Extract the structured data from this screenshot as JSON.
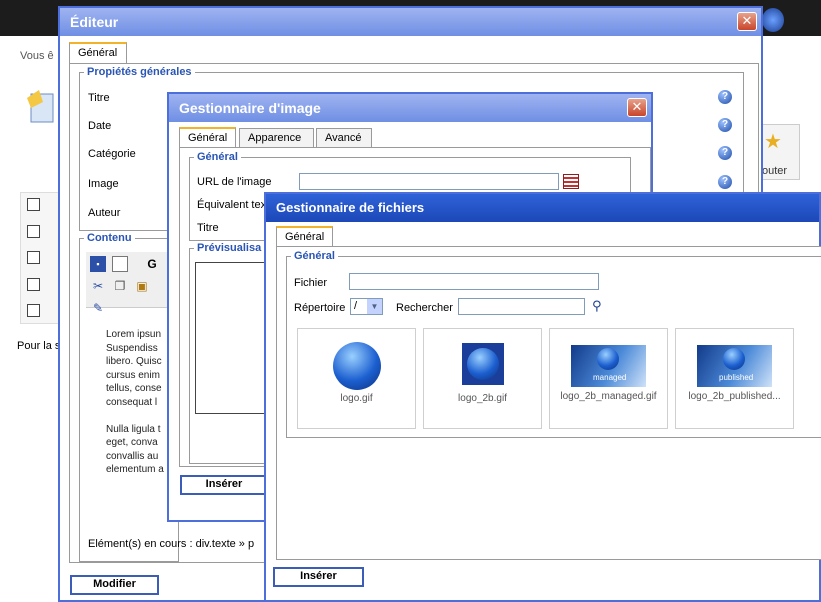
{
  "background": {
    "breadcrumb_fragment": "Vous ê",
    "page_text_fragment": "Pour la s",
    "add_button_fragment": "outer"
  },
  "editor": {
    "title": "Éditeur",
    "close_symbol": "✕",
    "tab_general": "Général",
    "legend_general": "Propiétés générales",
    "fields": [
      "Titre",
      "Date",
      "Catégorie",
      "Image",
      "Auteur"
    ],
    "legend_content": "Contenu",
    "bold_symbol": "G",
    "content_lines": [
      "Lorem ipsun",
      "Suspendiss",
      "libero. Quisc",
      "cursus enim",
      "tellus, conse",
      "consequat l"
    ],
    "content_lines2": [
      "Nulla ligula t",
      "eget, conva",
      "convallis au",
      "elementum a"
    ],
    "status": "Elément(s) en cours : div.texte » p",
    "modify_button": "Modifier"
  },
  "image_manager": {
    "title": "Gestionnaire d'image",
    "close_symbol": "✕",
    "tabs": [
      "Général",
      "Apparence",
      "Avancé"
    ],
    "legend_general": "Général",
    "url_label": "URL de l'image",
    "alt_label": "Équivalent tex",
    "title_label": "Titre",
    "legend_preview": "Prévisualisa",
    "insert_button": "Insérer"
  },
  "file_manager": {
    "title": "Gestionnaire de fichiers",
    "tab_general": "Général",
    "legend_general": "Général",
    "file_label": "Fichier",
    "directory_label": "Répertoire",
    "directory_value": "/",
    "search_label": "Rechercher",
    "files": [
      "logo.gif",
      "logo_2b.gif",
      "logo_2b_managed.gif",
      "logo_2b_published..."
    ],
    "thumb_overlay_managed": "managed",
    "thumb_overlay_published": "published",
    "insert_button": "Insérer"
  },
  "colors": {
    "title_gradient_light": "#9fb3f0",
    "title_dark": "#1c48b8",
    "legend_blue": "#2a55b5",
    "tab_accent": "#f2b32a"
  },
  "icons": {
    "save": "floppy-icon",
    "new": "new-document-icon",
    "cut": "scissors-icon",
    "copy": "copy-icon",
    "paste": "paste-icon",
    "help": "help-icon",
    "browse": "browse-calendar-icon",
    "search": "binoculars-icon"
  }
}
